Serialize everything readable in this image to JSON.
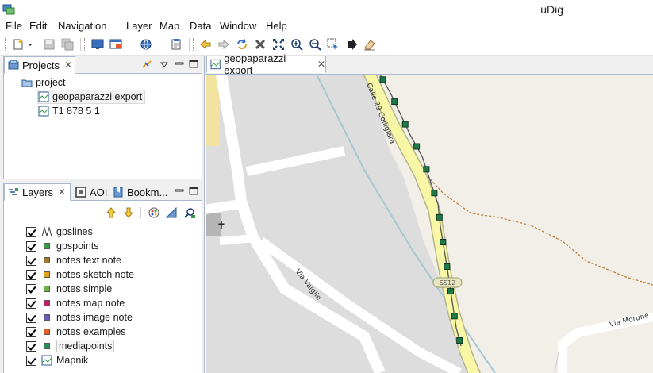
{
  "window": {
    "title": "uDig"
  },
  "menu": [
    "File",
    "Edit",
    "Navigation",
    "Layer",
    "Map",
    "Data",
    "Window",
    "Help"
  ],
  "projects_view": {
    "tab_label": "Projects",
    "tree": {
      "root": "project",
      "children": [
        "geopaparazzi export",
        "T1 878 5 1"
      ]
    }
  },
  "layers_view": {
    "tabs": [
      "Layers",
      "AOI",
      "Bookm..."
    ],
    "layers": [
      {
        "name": "gpslines",
        "type": "line",
        "checked": true
      },
      {
        "name": "gpspoints",
        "type": "point",
        "color": "#3a9a48",
        "checked": true
      },
      {
        "name": "notes text note",
        "type": "point",
        "color": "#9a7a2a",
        "checked": true
      },
      {
        "name": "notes sketch note",
        "type": "point",
        "color": "#e0a020",
        "checked": true
      },
      {
        "name": "notes simple",
        "type": "point",
        "color": "#6ab84a",
        "checked": true
      },
      {
        "name": "notes map note",
        "type": "point",
        "color": "#c0206a",
        "checked": true
      },
      {
        "name": "notes image note",
        "type": "point",
        "color": "#6a5ab0",
        "checked": true
      },
      {
        "name": "notes examples",
        "type": "point",
        "color": "#e0602a",
        "checked": true
      },
      {
        "name": "mediapoints",
        "type": "point",
        "color": "#2a8a5a",
        "checked": true
      },
      {
        "name": "Mapnik",
        "type": "raster",
        "checked": true
      }
    ]
  },
  "editor": {
    "tab_label": "geopaparazzi export"
  },
  "map": {
    "street_labels": [
      "Calle 29 Colligiara",
      "Via Vaiglie",
      "Via Morune"
    ],
    "road_shield": "SS12",
    "colors": {
      "background": "#f2efe9",
      "built_area": "#dddddd",
      "road_yellow": "#f7f7a6",
      "point_fill": "#1f7a4a"
    }
  }
}
